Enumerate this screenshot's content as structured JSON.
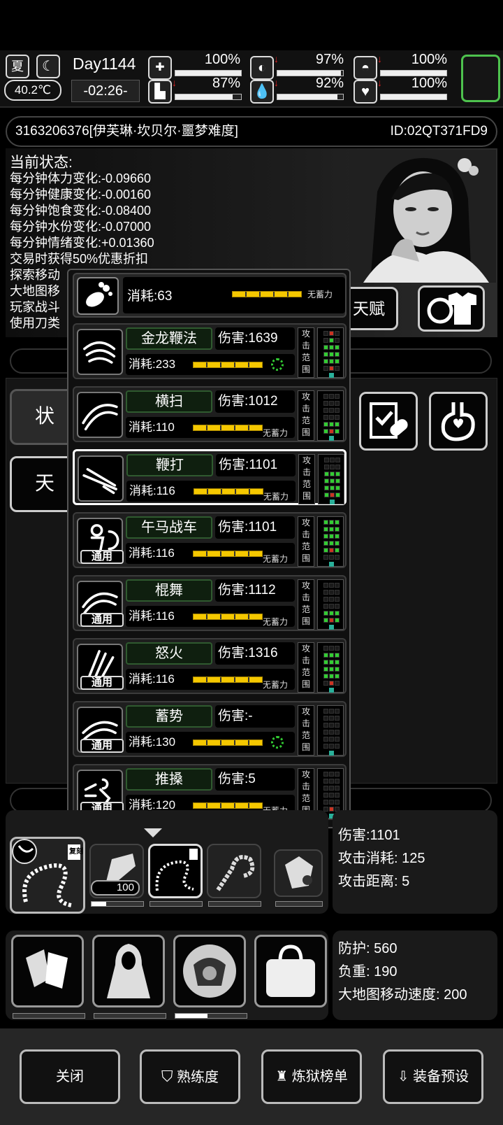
{
  "top": {
    "season": "夏",
    "temperature": "40.2℃",
    "day": "Day1144",
    "clock": "-02:26-",
    "stats": [
      {
        "name": "health",
        "value": "100%",
        "fill": 1.0,
        "down": false
      },
      {
        "name": "stomach",
        "value": "97%",
        "fill": 0.97,
        "down": true
      },
      {
        "name": "pill",
        "value": "100%",
        "fill": 1.0,
        "down": true
      },
      {
        "name": "stamina",
        "value": "87%",
        "fill": 0.87,
        "down": true
      },
      {
        "name": "water",
        "value": "92%",
        "fill": 0.92,
        "down": true
      },
      {
        "name": "mood",
        "value": "100%",
        "fill": 1.0,
        "down": true
      }
    ]
  },
  "player": {
    "name": "3163206376[伊芙琳·坎贝尔·噩梦难度]",
    "id": "ID:02QT371FD9"
  },
  "status": {
    "title": "当前状态:",
    "lines": [
      "每分钟体力变化:-0.09660",
      "每分钟健康变化:-0.00160",
      "每分钟饱食变化:-0.08400",
      "每分钟水份变化:-0.07000",
      "每分钟情绪变化:+0.01360",
      "交易时获得50%优惠折扣",
      "探索移动",
      "大地图移",
      "玩家战斗",
      "使用刀类"
    ]
  },
  "buttons": {
    "talent": "天赋",
    "status_tab": "状",
    "talent_tab": "天"
  },
  "popup": {
    "move_cost": "消耗:63",
    "no_charge": "无蓄力",
    "attack_range": [
      "攻",
      "击",
      "范",
      "围"
    ],
    "skills": [
      {
        "name": "金龙鞭法",
        "damage": "伤害:1639",
        "cost": "消耗:233",
        "charge": "ring",
        "tag": "",
        "selected": false
      },
      {
        "name": "横扫",
        "damage": "伤害:1012",
        "cost": "消耗:110",
        "charge": "无蓄力",
        "tag": "",
        "selected": false
      },
      {
        "name": "鞭打",
        "damage": "伤害:1101",
        "cost": "消耗:116",
        "charge": "无蓄力",
        "tag": "",
        "selected": true
      },
      {
        "name": "午马战车",
        "damage": "伤害:1101",
        "cost": "消耗:116",
        "charge": "无蓄力",
        "tag": "通用",
        "selected": false
      },
      {
        "name": "棍舞",
        "damage": "伤害:1112",
        "cost": "消耗:116",
        "charge": "无蓄力",
        "tag": "通用",
        "selected": false
      },
      {
        "name": "怒火",
        "damage": "伤害:1316",
        "cost": "消耗:116",
        "charge": "无蓄力",
        "tag": "通用",
        "selected": false
      },
      {
        "name": "蓄势",
        "damage": "伤害:-",
        "cost": "消耗:130",
        "charge": "ring",
        "tag": "通用",
        "selected": false
      },
      {
        "name": "推搡",
        "damage": "伤害:5",
        "cost": "消耗:120",
        "charge": "无蓄力",
        "tag": "通用",
        "selected": false
      }
    ]
  },
  "weapon": {
    "tag": "复刻",
    "ammo": "100",
    "info": [
      "伤害:1101",
      "攻击消耗: 125",
      "攻击距离: 5"
    ],
    "durability": [
      0.28,
      0.0,
      0.0,
      0.0
    ]
  },
  "gear": {
    "info": [
      "防护: 560",
      "负重: 190",
      "大地图移动速度: 200"
    ],
    "durability": [
      0.0,
      0.0,
      0.45
    ]
  },
  "footer": {
    "close": "关闭",
    "proficiency": "熟练度",
    "ranking": "炼狱榜单",
    "preset": "装备预设"
  },
  "colors": {
    "green": "#33cc33",
    "yellow": "#f5c800",
    "red": "#e02020"
  }
}
